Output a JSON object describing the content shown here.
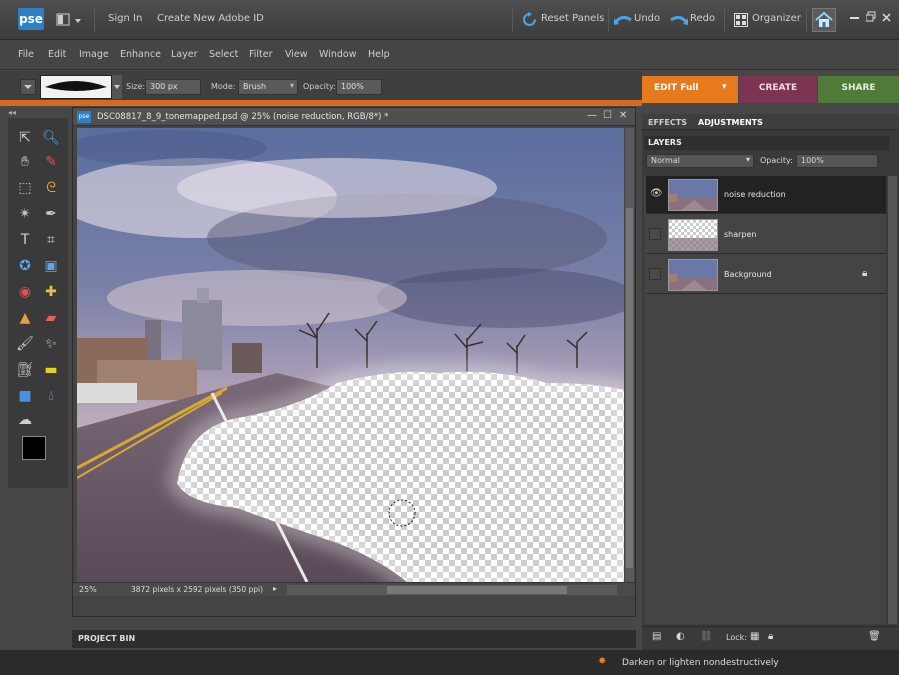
{
  "app": {
    "logo": "pse",
    "signin": "Sign In",
    "create_id": "Create New Adobe ID",
    "reset_panels": "Reset Panels",
    "undo": "Undo",
    "redo": "Redo",
    "organizer": "Organizer"
  },
  "menu": [
    "File",
    "Edit",
    "Image",
    "Enhance",
    "Layer",
    "Select",
    "Filter",
    "View",
    "Window",
    "Help"
  ],
  "options": {
    "size_label": "Size:",
    "size_value": "300 px",
    "mode_label": "Mode:",
    "mode_value": "Brush",
    "opacity_label": "Opacity:",
    "opacity_value": "100%"
  },
  "mode_tabs": {
    "edit": "EDIT Full",
    "create": "CREATE",
    "share": "SHARE"
  },
  "document": {
    "title": "DSC08817_8_9_tonemapped.psd @ 25% (noise reduction, RGB/8*) *",
    "zoom": "25%",
    "dimensions": "3872 pixels x 2592 pixels (350 ppi)"
  },
  "project_bin": "PROJECT BIN",
  "panel": {
    "tab_effects": "EFFECTS",
    "tab_adjustments": "ADJUSTMENTS",
    "layers_title": "LAYERS",
    "blend_mode": "Normal",
    "opacity_label": "Opacity:",
    "opacity_value": "100%",
    "layers": [
      {
        "name": "noise reduction"
      },
      {
        "name": "sharpen"
      },
      {
        "name": "Background"
      }
    ],
    "lock_label": "Lock:"
  },
  "status": {
    "hint": "Darken or lighten nondestructively"
  },
  "colors": {
    "accent_orange": "#e57a1f",
    "create_purple": "#7b3552",
    "share_green": "#4f7a3a"
  }
}
